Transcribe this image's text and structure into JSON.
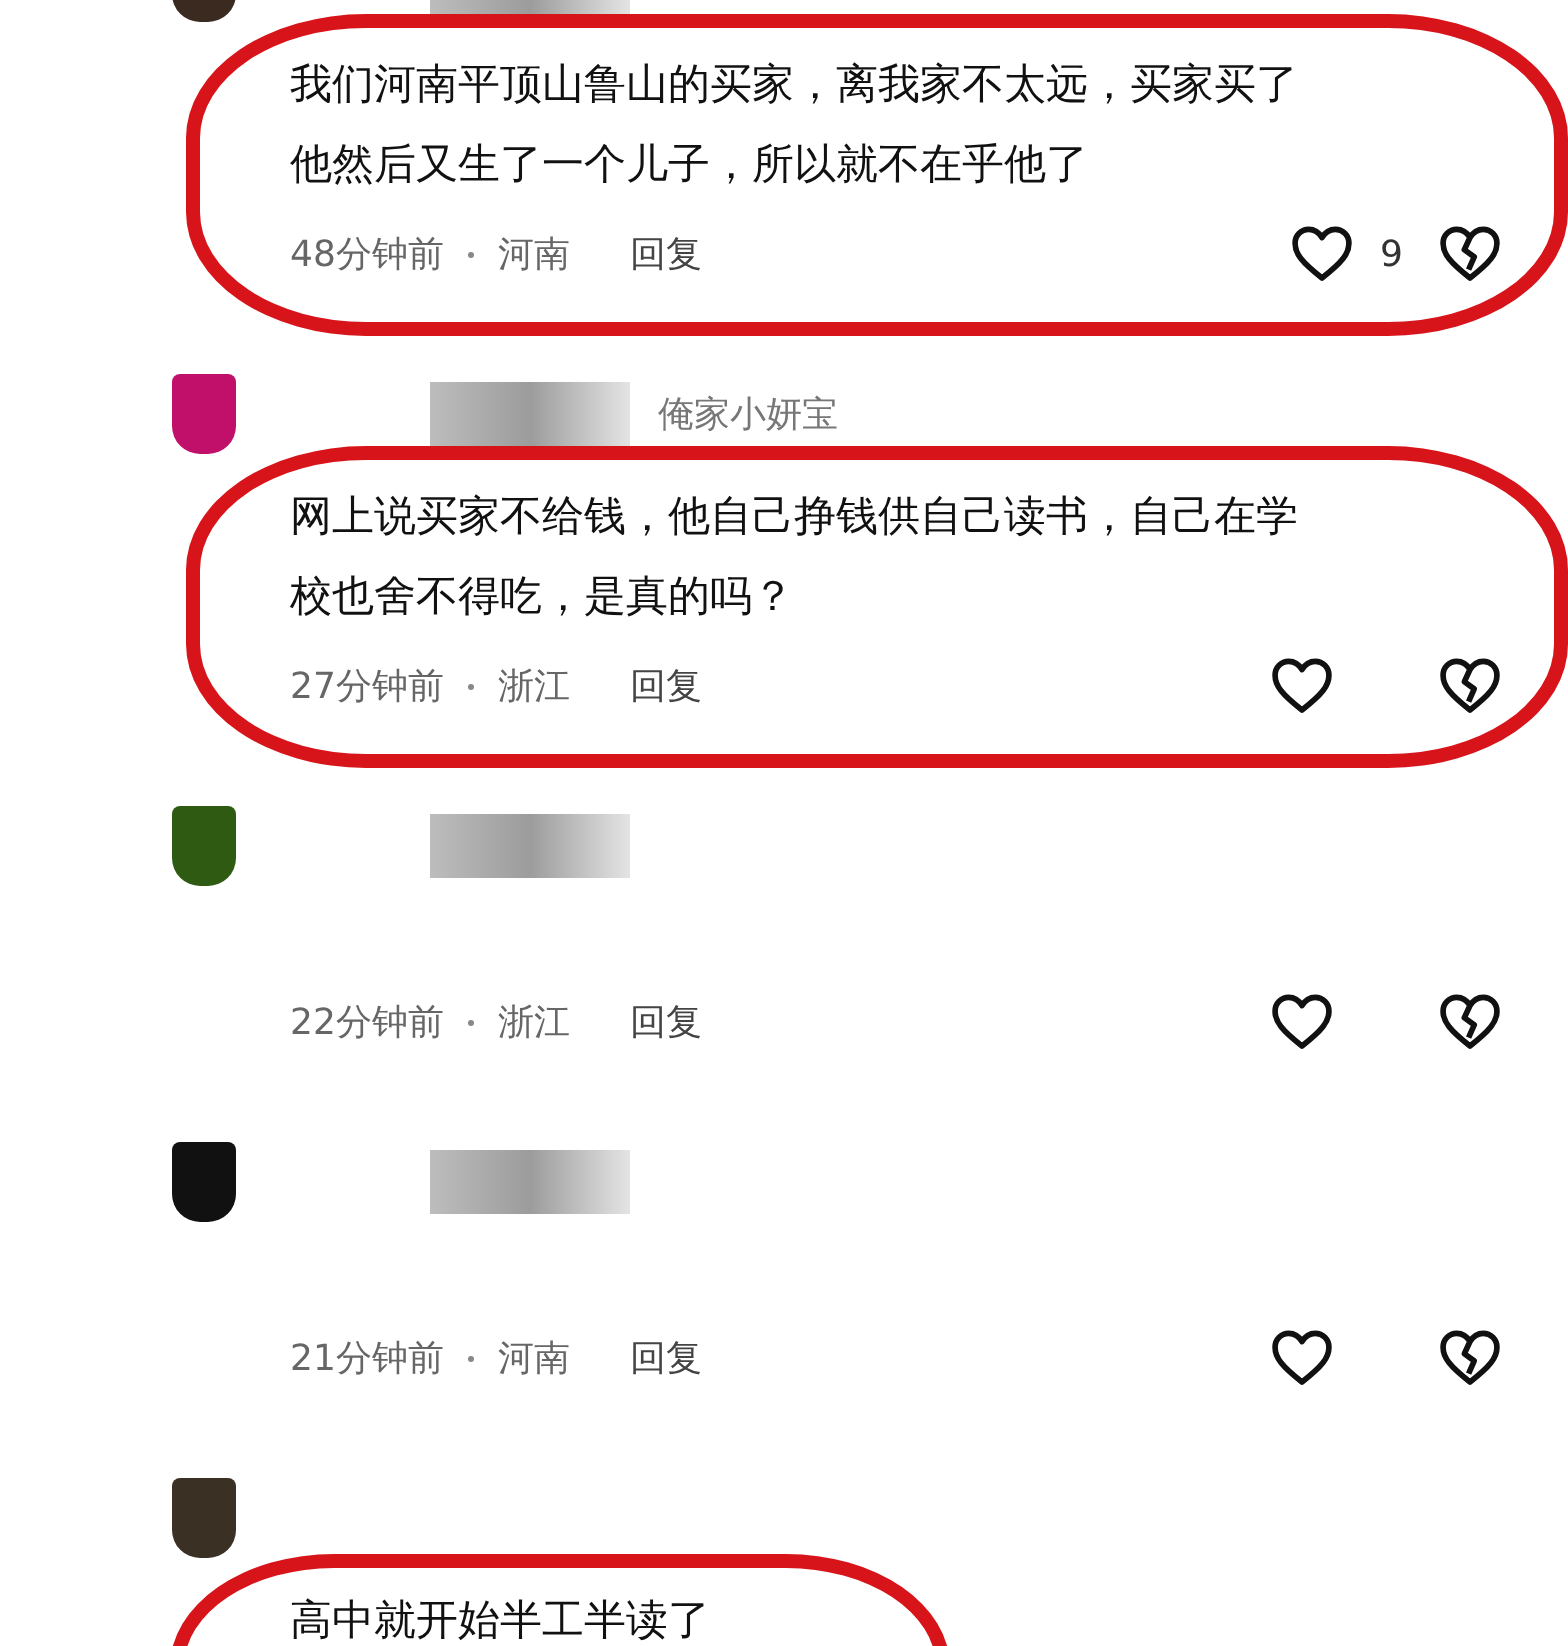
{
  "comments": [
    {
      "avatar": {
        "color": "#3a2a20"
      },
      "name_blurred": true,
      "text_lines": [
        "我们河南平顶山鲁山的买家，离我家不太远，买家买了",
        "他然后又生了一个儿子，所以就不在乎他了"
      ],
      "meta": {
        "time": "48分钟前",
        "location": "河南",
        "reply": "回复",
        "likes": "9"
      },
      "circled": true
    },
    {
      "avatar": {
        "color": "#c0106a"
      },
      "name_blurred": true,
      "name": "俺家小妍宝",
      "text_lines": [
        "网上说买家不给钱，他自己挣钱供自己读书，自己在学",
        "校也舍不得吃，是真的吗？"
      ],
      "meta": {
        "time": "27分钟前",
        "location": "浙江",
        "reply": "回复"
      },
      "circled": true
    },
    {
      "avatar": {
        "color": "#2f5a12"
      },
      "name_blurred": true,
      "meta": {
        "time": "22分钟前",
        "location": "浙江",
        "reply": "回复"
      },
      "circled": false
    },
    {
      "avatar": {
        "color": "#111111"
      },
      "name_blurred": true,
      "meta": {
        "time": "21分钟前",
        "location": "河南",
        "reply": "回复"
      },
      "circled": false
    },
    {
      "avatar": {
        "color": "#3b3024"
      },
      "name_blurred": false,
      "text_lines": [
        "高中就开始半工半读了"
      ],
      "circled": true
    }
  ]
}
